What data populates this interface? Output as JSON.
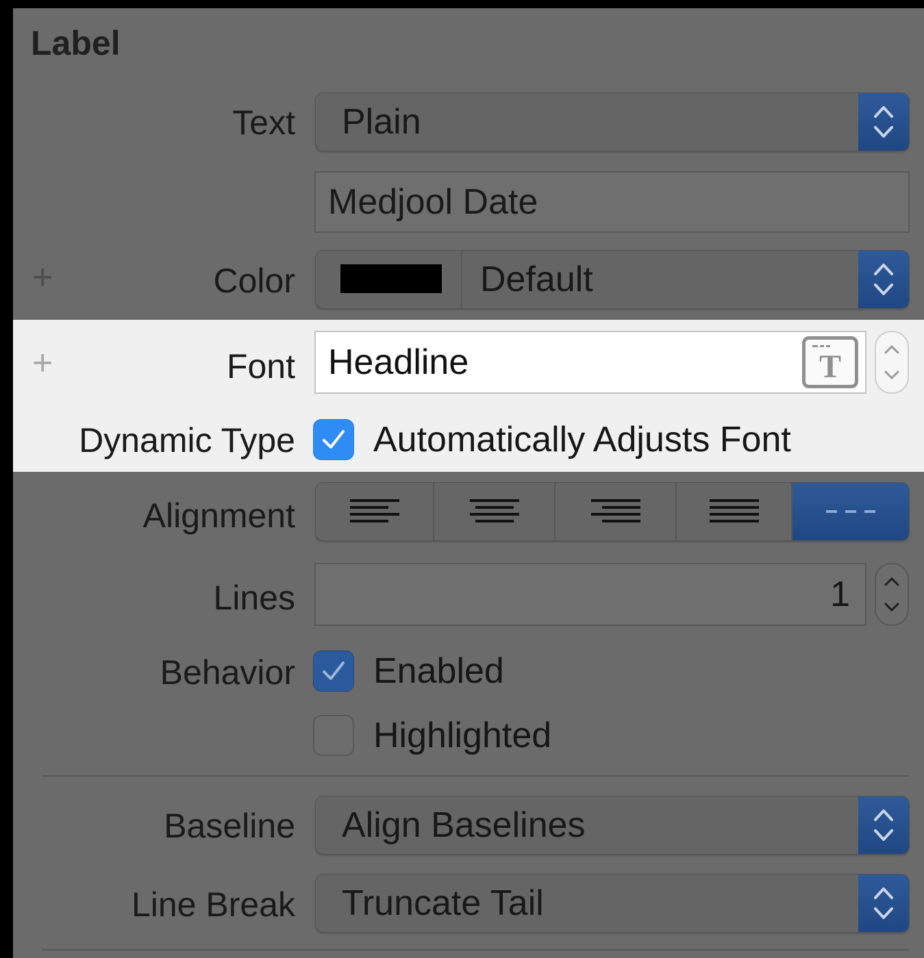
{
  "section_title": "Label",
  "text_row": {
    "label": "Text",
    "value": "Plain",
    "content": "Medjool Date"
  },
  "color_row": {
    "label": "Color",
    "value": "Default",
    "swatch": "#000000",
    "add_icon": "plus-icon"
  },
  "font_row": {
    "label": "Font",
    "value": "Headline",
    "font_icon": "font-picker-icon",
    "add_icon": "plus-icon"
  },
  "dynamic_type": {
    "label": "Dynamic Type",
    "checkbox_label": "Automatically Adjusts Font",
    "checked": true
  },
  "alignment": {
    "label": "Alignment",
    "options": [
      "left-align-icon",
      "center-align-icon",
      "right-align-icon",
      "justify-icon",
      "natural-align-icon"
    ],
    "selected": "natural-align-icon"
  },
  "lines": {
    "label": "Lines",
    "value": "1"
  },
  "behavior": {
    "label": "Behavior",
    "enabled_label": "Enabled",
    "enabled": true,
    "highlighted_label": "Highlighted",
    "highlighted": false
  },
  "baseline": {
    "label": "Baseline",
    "value": "Align Baselines"
  },
  "line_break": {
    "label": "Line Break",
    "value": "Truncate Tail"
  },
  "colors": {
    "accent": "#2f8cf5",
    "panel": "#6b6b6b",
    "highlight": "#f0f0f0"
  }
}
